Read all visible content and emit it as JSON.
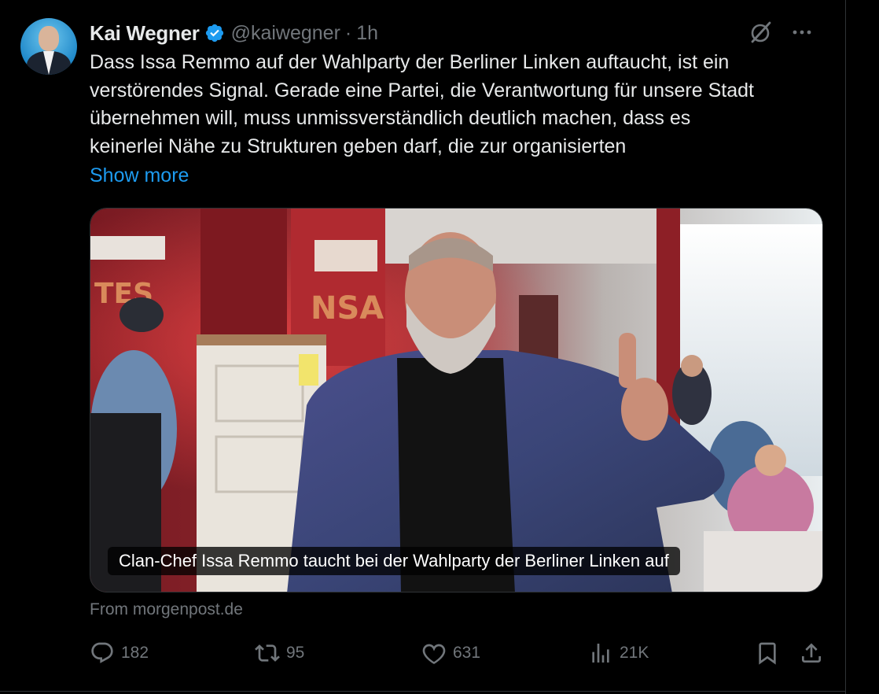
{
  "tweet": {
    "author_name": "Kai Wegner",
    "handle": "@kaiwegner",
    "separator": "·",
    "time": "1h",
    "text_lines": [
      "Dass Issa Remmo auf der Wahlparty der Berliner Linken auftaucht, ist ein",
      "verstörendes Signal. Gerade eine Partei, die Verantwortung für unsere Stadt",
      "übernehmen will, muss unmissverständlich deutlich machen, dass es",
      "keinerlei Nähe zu Strukturen geben darf, die zur organisierten"
    ],
    "show_more": "Show more"
  },
  "media": {
    "caption": "Clan-Chef Issa Remmo taucht bei der Wahlparty der Berliner Linken auf",
    "source": "From morgenpost.de"
  },
  "actions": {
    "replies": "182",
    "reposts": "95",
    "likes": "631",
    "views": "21K"
  },
  "icons": {
    "verified": "verified-badge-icon",
    "grok": "grok-icon",
    "more": "more-icon",
    "reply": "reply-icon",
    "repost": "repost-icon",
    "like": "like-icon",
    "views": "views-icon",
    "bookmark": "bookmark-icon",
    "share": "share-icon"
  },
  "colors": {
    "background": "#000000",
    "text": "#e7e9ea",
    "muted": "#71767b",
    "link": "#1d9bf0",
    "verified": "#1d9bf0"
  }
}
